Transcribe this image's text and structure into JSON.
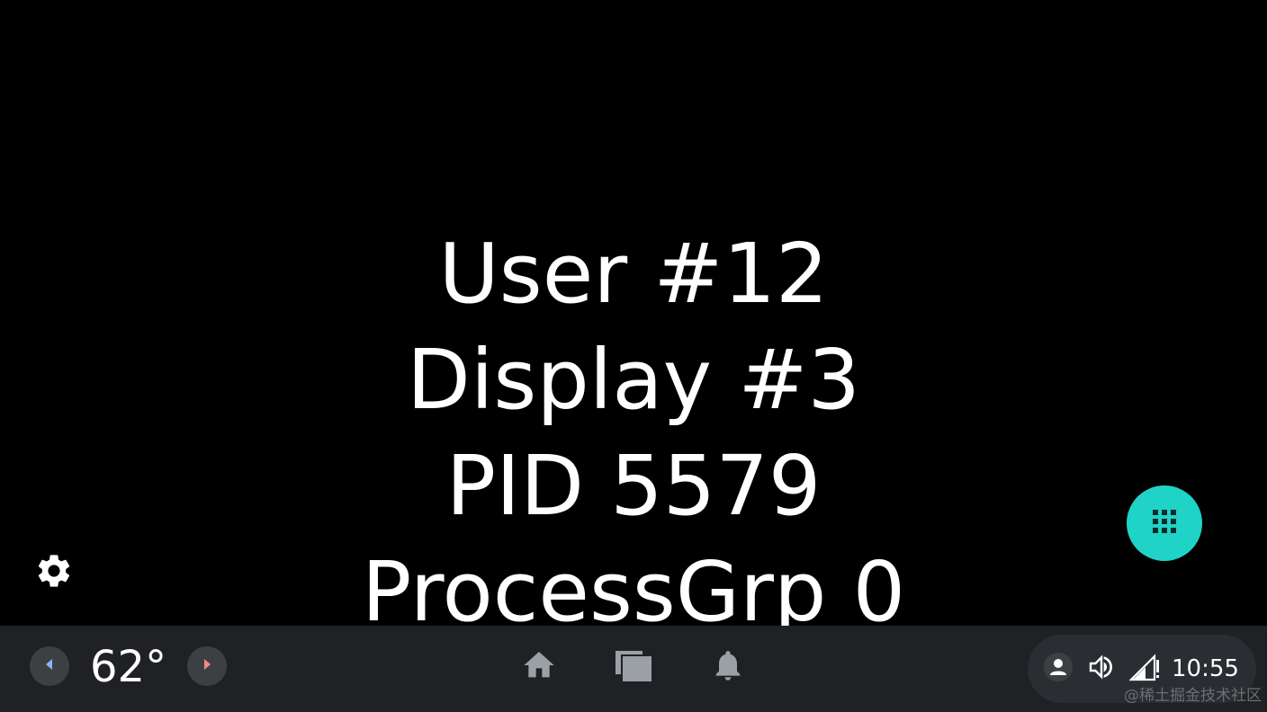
{
  "display_info": {
    "lines": [
      "User #12",
      "Display #3",
      "PID 5579",
      "ProcessGrp 0"
    ]
  },
  "settings": {
    "icon": "gear-icon"
  },
  "app_launcher": {
    "icon": "apps-grid-icon",
    "color": "#1fd3c6"
  },
  "navbar": {
    "background": "#202124",
    "temperature": {
      "value": "62°",
      "decrease_icon": "chevron-left-icon",
      "increase_icon": "chevron-right-icon",
      "decrease_color": "#8ab4f8",
      "increase_color": "#f28b82"
    },
    "icons": {
      "home": "home-icon",
      "recents": "recents-icon",
      "notifications": "bell-icon"
    },
    "status": {
      "user_icon": "user-icon",
      "volume_icon": "volume-icon",
      "signal_icon": "signal-icon",
      "time": "10:55"
    }
  },
  "watermark": "@稀土掘金技术社区"
}
